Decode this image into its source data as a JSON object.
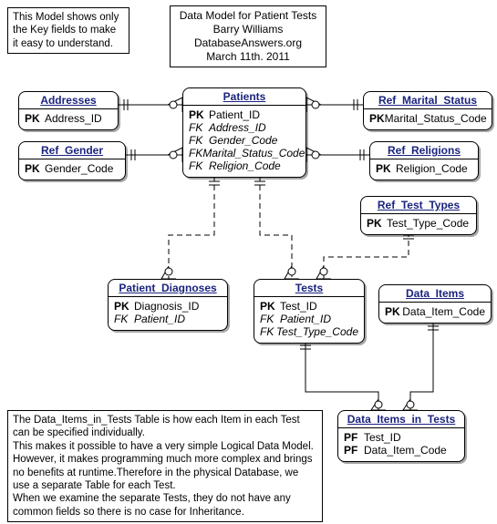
{
  "header": {
    "line1": "Data Model for Patient Tests",
    "line2": "Barry Williams",
    "line3": "DatabaseAnswers.org",
    "line4": "March 11th. 2011"
  },
  "note_top": {
    "line1": "This Model shows only",
    "line2": "the Key fields to make",
    "line3": "it easy to understand."
  },
  "entities": {
    "addresses": {
      "title": "Addresses",
      "rows": [
        {
          "key": "PK",
          "name": "Address_ID"
        }
      ]
    },
    "ref_gender": {
      "title": "Ref_Gender",
      "rows": [
        {
          "key": "PK",
          "name": "Gender_Code"
        }
      ]
    },
    "patients": {
      "title": "Patients",
      "rows": [
        {
          "key": "PK",
          "name": "Patient_ID"
        },
        {
          "key": "FK",
          "name": "Address_ID"
        },
        {
          "key": "FK",
          "name": "Gender_Code"
        },
        {
          "key": "FK",
          "name": "Marital_Status_Code"
        },
        {
          "key": "FK",
          "name": "Religion_Code"
        }
      ]
    },
    "ref_marital": {
      "title": "Ref_Marital_Status",
      "rows": [
        {
          "key": "PK",
          "name": "Marital_Status_Code"
        }
      ]
    },
    "ref_religions": {
      "title": "Ref_Religions",
      "rows": [
        {
          "key": "PK",
          "name": "Religion_Code"
        }
      ]
    },
    "ref_test_types": {
      "title": "Ref_Test_Types",
      "rows": [
        {
          "key": "PK",
          "name": "Test_Type_Code"
        }
      ]
    },
    "patient_diagnoses": {
      "title": "Patient_Diagnoses",
      "rows": [
        {
          "key": "PK",
          "name": "Diagnosis_ID"
        },
        {
          "key": "FK",
          "name": "Patient_ID"
        }
      ]
    },
    "tests": {
      "title": "Tests",
      "rows": [
        {
          "key": "PK",
          "name": "Test_ID"
        },
        {
          "key": "FK",
          "name": "Patient_ID"
        },
        {
          "key": "FK",
          "name": "Test_Type_Code"
        }
      ]
    },
    "data_items": {
      "title": "Data_Items",
      "rows": [
        {
          "key": "PK",
          "name": "Data_Item_Code"
        }
      ]
    },
    "data_items_in_tests": {
      "title": "Data_Items_in_Tests",
      "rows": [
        {
          "key": "PF",
          "name": "Test_ID"
        },
        {
          "key": "PF",
          "name": "Data_Item_Code"
        }
      ]
    }
  },
  "note_bottom": {
    "l1": "The Data_Items_in_Tests Table is how  each Item in each Test",
    "l2": "can be specified individually.",
    "l3": "This makes it possible to have a very simple Logical Data Model.",
    "l4": "However, it makes programming much more complex and brings",
    "l5": "no benefits at runtime.Therefore in the physical Database, we",
    "l6": "use a separate Table for each Test.",
    "l7": "When we examine the separate Tests, they do not have any",
    "l8": "common fields so there is no case for Inheritance."
  }
}
